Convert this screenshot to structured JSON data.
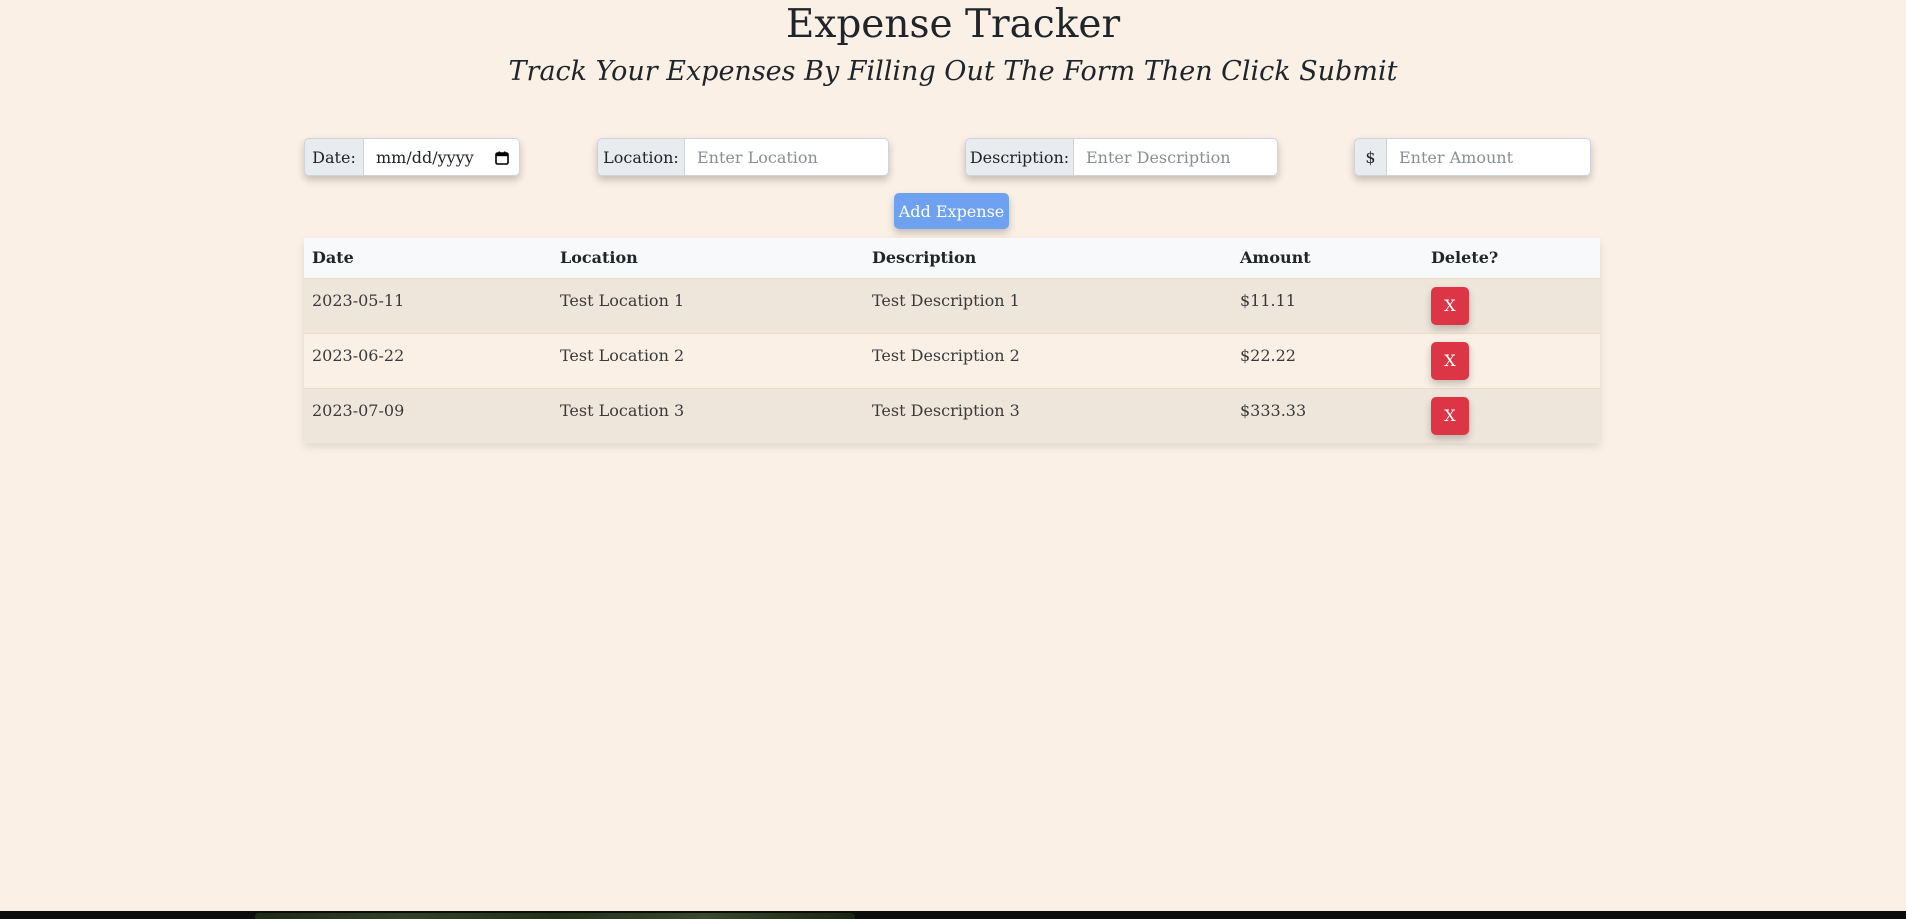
{
  "header": {
    "title": "Expense Tracker",
    "subtitle": "Track Your Expenses By Filling Out The Form Then Click Submit"
  },
  "form": {
    "date_label": "Date:",
    "date_placeholder": "mm/dd/yyyy",
    "location_label": "Location:",
    "location_placeholder": "Enter Location",
    "description_label": "Description:",
    "description_placeholder": "Enter Description",
    "amount_label": "$",
    "amount_placeholder": "Enter Amount",
    "submit_label": "Add Expense"
  },
  "table": {
    "columns": [
      "Date",
      "Location",
      "Description",
      "Amount",
      "Delete?"
    ],
    "rows": [
      {
        "date": "2023-05-11",
        "location": "Test Location 1",
        "description": "Test Description 1",
        "amount": "$11.11",
        "delete_label": "X"
      },
      {
        "date": "2023-06-22",
        "location": "Test Location 2",
        "description": "Test Description 2",
        "amount": "$22.22",
        "delete_label": "X"
      },
      {
        "date": "2023-07-09",
        "location": "Test Location 3",
        "description": "Test Description 3",
        "amount": "$333.33",
        "delete_label": "X"
      }
    ]
  },
  "colors": {
    "background": "#faf0e6",
    "primary_button": "#6ea2f0",
    "danger_button": "#dc3545",
    "addon": "#e9ecef"
  },
  "icons": {
    "date_picker": "calendar-icon"
  }
}
